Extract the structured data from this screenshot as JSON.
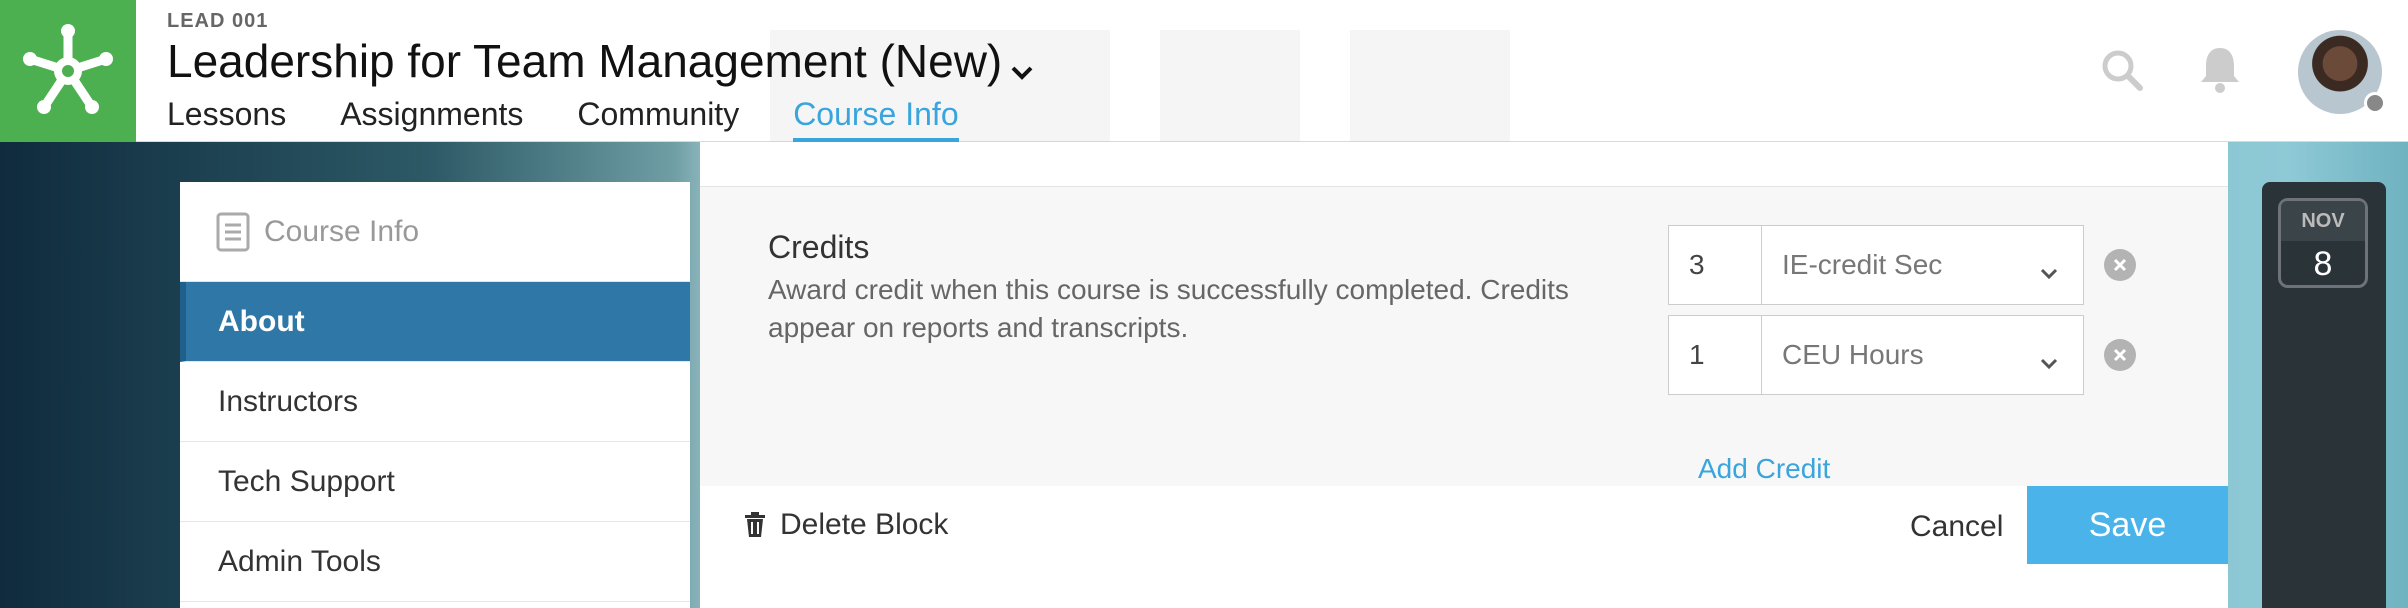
{
  "header": {
    "course_code": "LEAD 001",
    "course_title": "Leadership for Team Management (New)",
    "nav": [
      {
        "label": "Lessons"
      },
      {
        "label": "Assignments"
      },
      {
        "label": "Community"
      },
      {
        "label": "Course Info",
        "active": true
      }
    ],
    "accent": "#3aa5dc",
    "logo_color": "#4caf50"
  },
  "sidebar": {
    "heading": "Course Info",
    "items": [
      {
        "label": "About",
        "active": true
      },
      {
        "label": "Instructors"
      },
      {
        "label": "Tech Support"
      },
      {
        "label": "Admin Tools"
      }
    ]
  },
  "credits": {
    "title": "Credits",
    "description": "Award credit when this course is successfully completed. Credits appear on reports and transcripts.",
    "rows": [
      {
        "amount": "3",
        "type": "IE-credit Sec"
      },
      {
        "amount": "1",
        "type": "CEU Hours"
      }
    ],
    "add_label": "Add Credit"
  },
  "footer": {
    "delete_label": "Delete Block",
    "cancel_label": "Cancel",
    "save_label": "Save",
    "save_color": "#4ab3ea"
  },
  "calendar": {
    "month": "NOV",
    "day": "8"
  }
}
